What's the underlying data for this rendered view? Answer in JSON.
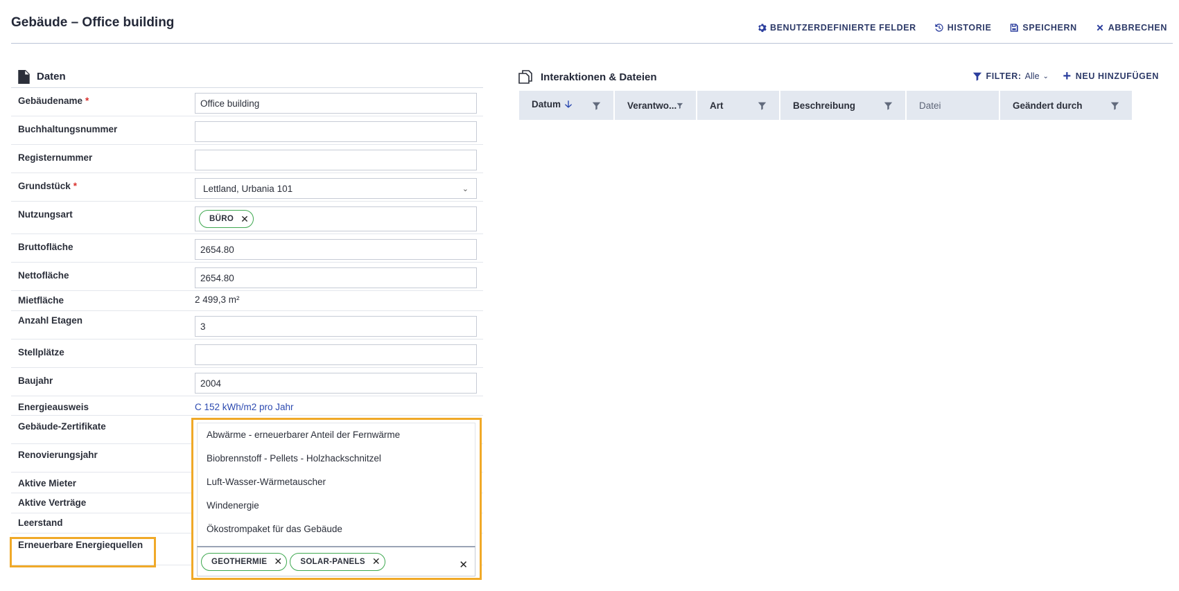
{
  "header": {
    "title": "Gebäude – Office building",
    "actions": {
      "custom_fields": "BENUTZERDEFINIERTE FELDER",
      "history": "HISTORIE",
      "save": "SPEICHERN",
      "cancel": "ABBRECHEN"
    }
  },
  "data_section": {
    "title": "Daten",
    "fields": {
      "building_name": {
        "label": "Gebäudename",
        "required": "*",
        "value": "Office building"
      },
      "accounting_number": {
        "label": "Buchhaltungsnummer",
        "value": ""
      },
      "register_number": {
        "label": "Registernummer",
        "value": ""
      },
      "plot": {
        "label": "Grundstück",
        "required": "*",
        "value": "Lettland, Urbania 101"
      },
      "usage_type": {
        "label": "Nutzungsart",
        "tags": [
          "BÜRO"
        ]
      },
      "gross_area": {
        "label": "Bruttofläche",
        "value": "2654.80"
      },
      "net_area": {
        "label": "Nettofläche",
        "value": "2654.80"
      },
      "rental_area": {
        "label": "Mietfläche",
        "value": "2 499,3 m²"
      },
      "floors": {
        "label": "Anzahl Etagen",
        "value": "3"
      },
      "parking": {
        "label": "Stellplätze",
        "value": ""
      },
      "year_built": {
        "label": "Baujahr",
        "value": "2004"
      },
      "energy_certificate": {
        "label": "Energieausweis",
        "value": "C 152 kWh/m2 pro Jahr"
      },
      "building_certificates": {
        "label": "Gebäude-Zertifikate"
      },
      "renovation_year": {
        "label": "Renovierungsjahr"
      },
      "active_tenants": {
        "label": "Aktive Mieter"
      },
      "active_contracts": {
        "label": "Aktive Verträge"
      },
      "vacancy": {
        "label": "Leerstand"
      },
      "renewable_sources": {
        "label": "Erneuerbare Energiequellen",
        "tags": [
          "GEOTHERMIE",
          "SOLAR-PANELS"
        ],
        "options": [
          "Abwärme - erneuerbarer Anteil der Fernwärme",
          "Biobrennstoff - Pellets - Holzhackschnitzel",
          "Luft-Wasser-Wärmetauscher",
          "Windenergie",
          "Ökostrompaket für das Gebäude"
        ]
      }
    }
  },
  "interactions": {
    "title": "Interaktionen & Dateien",
    "filter_label": "FILTER:",
    "filter_value": "Alle",
    "add_label": "NEU HINZUFÜGEN",
    "columns": [
      "Datum",
      "Verantwo...",
      "Art",
      "Beschreibung",
      "Datei",
      "Geändert durch"
    ]
  },
  "colors": {
    "accent": "#2c3f9e",
    "tag_border": "#3ea84f",
    "highlight": "#f0a928",
    "required": "#d9302c"
  }
}
